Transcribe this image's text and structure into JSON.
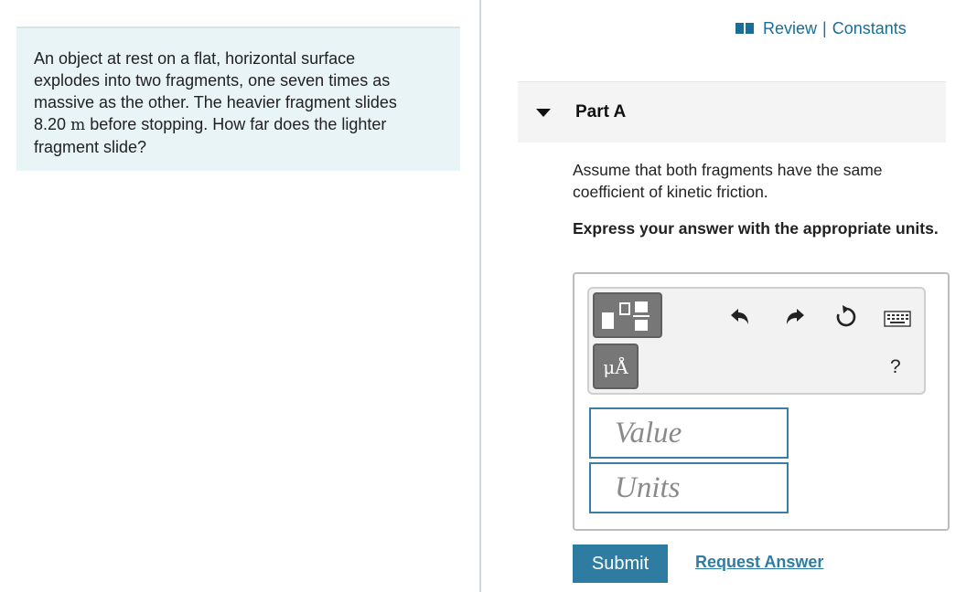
{
  "problem": {
    "line1": "An object at rest on a flat, horizontal surface",
    "line2": "explodes into two fragments, one seven times as",
    "line3": "massive as the other. The heavier fragment slides",
    "distance_value": "8.20",
    "distance_unit": "m",
    "line4_rest": " before stopping. How far does the lighter",
    "line5": "fragment slide?"
  },
  "header_links": {
    "review": "Review",
    "separator": "|",
    "constants": "Constants"
  },
  "part": {
    "title": "Part A",
    "instruction": "Assume that both fragments have the same coefficient of kinetic friction.",
    "express": "Express your answer with the appropriate units."
  },
  "toolbar": {
    "units_label": "μÅ",
    "help_label": "?",
    "icons": [
      "templates-icon",
      "units-icon",
      "undo-icon",
      "redo-icon",
      "reset-icon",
      "keyboard-icon",
      "help-icon"
    ]
  },
  "inputs": {
    "value_placeholder": "Value",
    "units_placeholder": "Units"
  },
  "actions": {
    "submit": "Submit",
    "request_answer": "Request Answer"
  },
  "colors": {
    "accent": "#2f7ca2",
    "problem_bg": "#e8f4f6",
    "link": "#1a6e96"
  }
}
